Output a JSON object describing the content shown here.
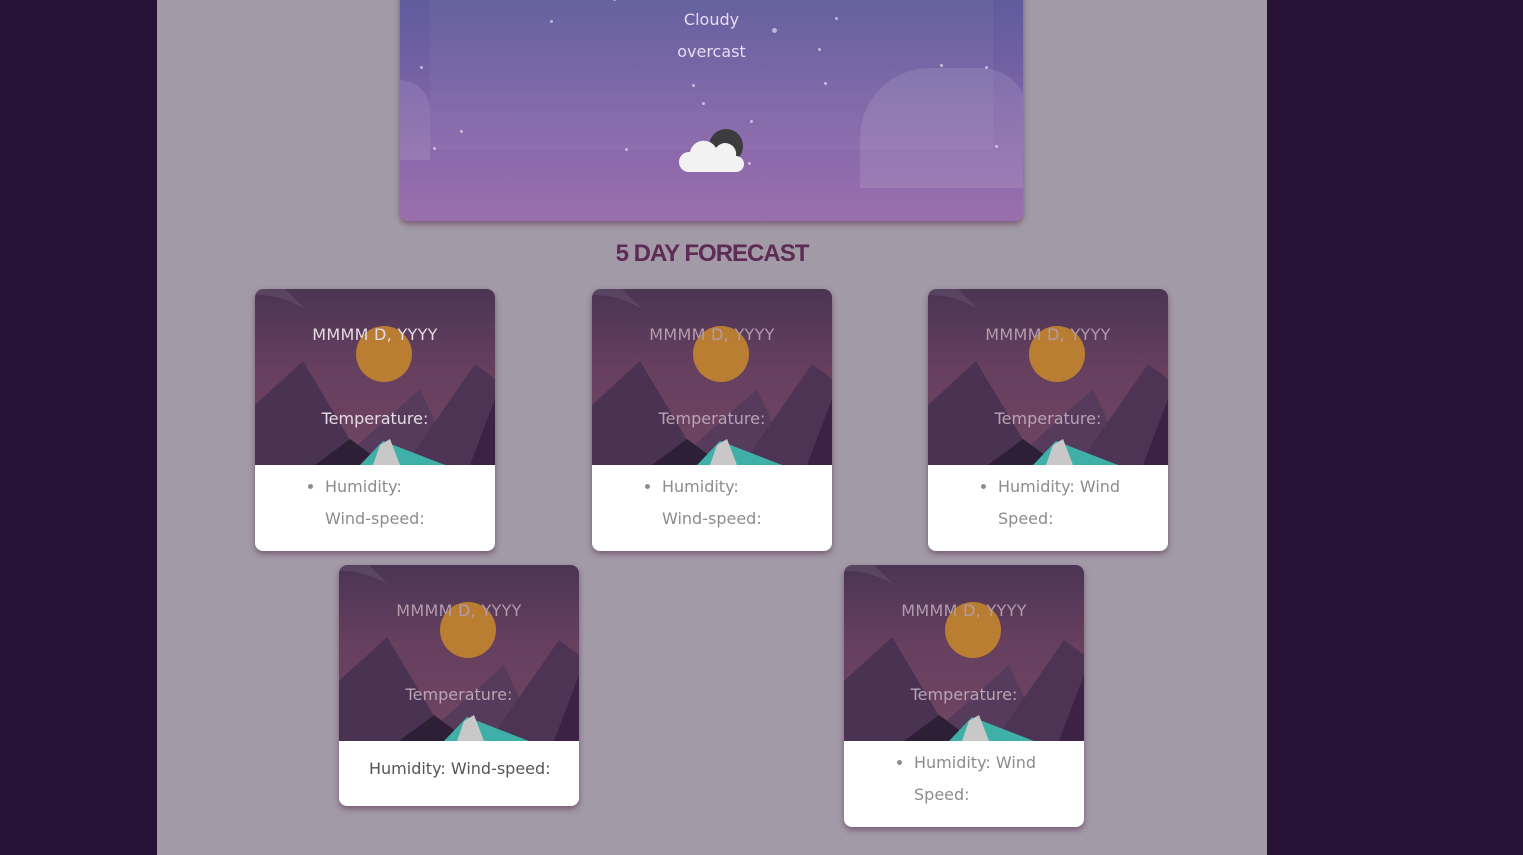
{
  "current": {
    "condition": "Cloudy",
    "description": "overcast",
    "icon": "cloud-moon-icon"
  },
  "forecast": {
    "title": "5 DAY FORECAST",
    "cards": [
      {
        "date": "MMMM D, YYYY",
        "temperature_label": "Temperature:",
        "humidity_label": "Humidity:",
        "wind_label": "Wind-speed:"
      },
      {
        "date": "MMMM D, YYYY",
        "temperature_label": "Temperature:",
        "humidity_label": "Humidity:",
        "wind_label": "Wind-speed:"
      },
      {
        "date": "MMMM D, YYYY",
        "temperature_label": "Temperature:",
        "details": "Humidity: Wind Speed:"
      },
      {
        "date": "MMMM D, YYYY",
        "temperature_label": "Temperature:",
        "details": "Humidity: Wind-speed:"
      },
      {
        "date": "MMMM D, YYYY",
        "temperature_label": "Temperature:",
        "details": "Humidity: Wind Speed:"
      }
    ]
  },
  "colors": {
    "outer_background": "#261335",
    "page_background": "#a29aa6",
    "title_color": "#5e2b55",
    "sun": "#c98a2a"
  }
}
